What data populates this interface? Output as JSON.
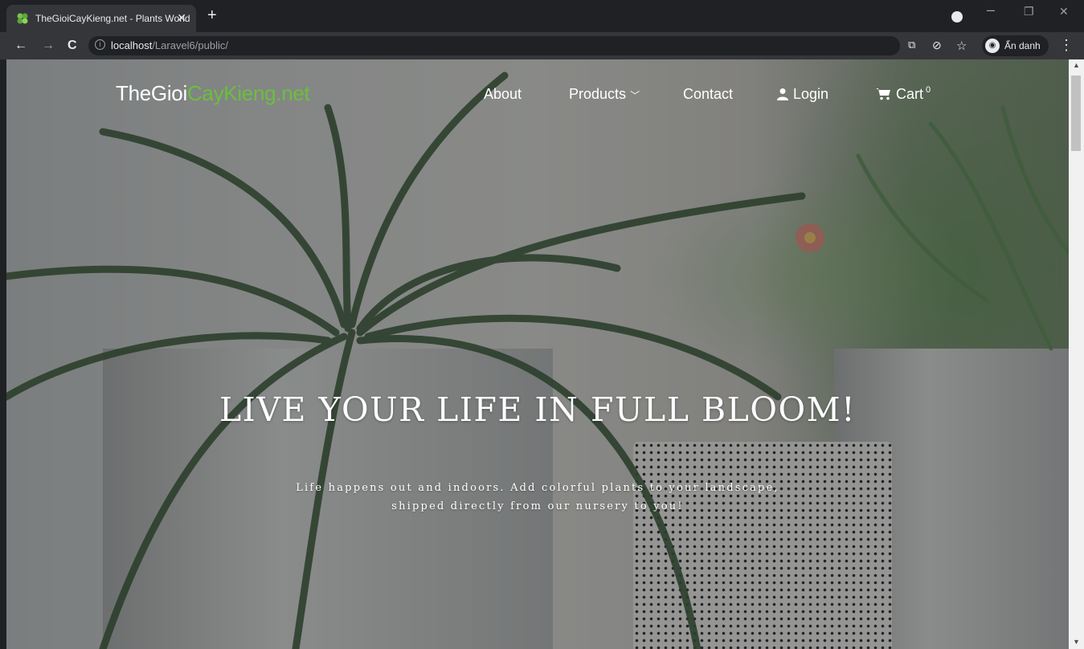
{
  "browser": {
    "tab_title": "TheGioiCayKieng.net - Plants World",
    "tab_close": "✕",
    "new_tab": "+",
    "url_host": "localhost",
    "url_path": "/Laravel6/public/",
    "profile_label": "Ẩn danh"
  },
  "site": {
    "brand_part1": "TheGioi",
    "brand_part2": "CayKieng.net",
    "brand_accent_color": "#6bbf3c",
    "nav": {
      "about": "About",
      "products": "Products",
      "contact": "Contact",
      "login": "Login",
      "cart": "Cart",
      "cart_count": "0"
    },
    "hero": {
      "title": "LIVE YOUR LIFE IN FULL BLOOM!",
      "subtitle_line1": "Life happens out and indoors. Add colorful plants to your landscape,",
      "subtitle_line2": "shipped directly from our nursery to you!"
    }
  },
  "icons": {
    "favicon": "clover-icon",
    "back": "arrow-left-icon",
    "forward": "arrow-right-icon",
    "reload": "reload-icon",
    "info": "info-icon",
    "translate": "translate-icon",
    "eye_off": "eye-off-icon",
    "bookmark": "star-icon",
    "incognito": "incognito-icon",
    "menu": "kebab-menu-icon",
    "user": "user-icon",
    "cart": "cart-icon",
    "chevron": "chevron-down-icon"
  }
}
